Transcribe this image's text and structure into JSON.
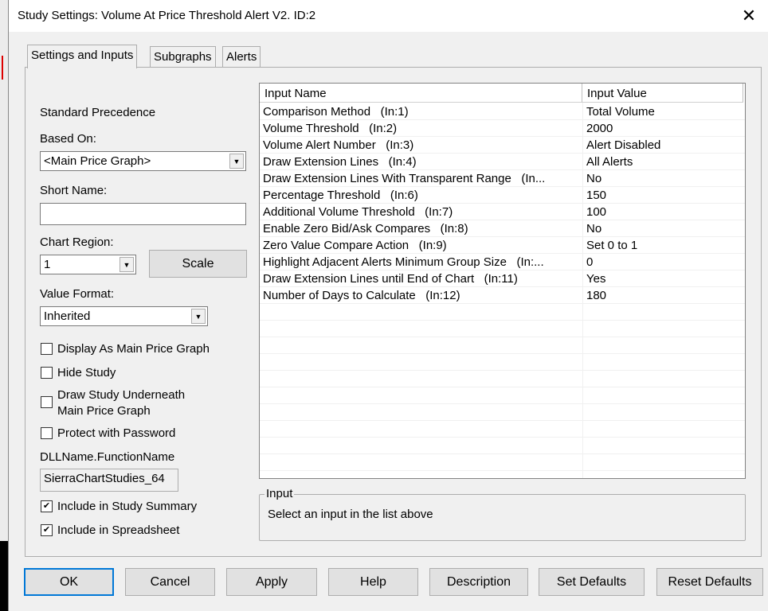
{
  "window": {
    "title": "Study Settings: Volume At Price Threshold Alert V2. ID:2",
    "close": "✕"
  },
  "tabs": [
    {
      "label": "Settings and Inputs"
    },
    {
      "label": "Subgraphs"
    },
    {
      "label": "Alerts"
    }
  ],
  "left": {
    "standard_precedence": "Standard Precedence",
    "based_on_label": "Based On:",
    "based_on_value": "<Main Price Graph>",
    "short_name_label": "Short Name:",
    "short_name_value": "",
    "chart_region_label": "Chart Region:",
    "chart_region_value": "1",
    "scale_button": "Scale",
    "value_format_label": "Value Format:",
    "value_format_value": "Inherited",
    "checkboxes": [
      {
        "label": "Display As Main Price Graph",
        "checked": false
      },
      {
        "label": "Hide Study",
        "checked": false
      },
      {
        "label": "Draw Study Underneath",
        "label2": "Main Price Graph",
        "checked": false
      },
      {
        "label": "Protect with Password",
        "checked": false
      }
    ],
    "dll_label": "DLLName.FunctionName",
    "dll_value": "SierraChartStudies_64",
    "include": [
      {
        "label": "Include in Study Summary",
        "checked": true,
        "mark": "✔"
      },
      {
        "label": "Include in Spreadsheet",
        "checked": true,
        "mark": "✔"
      }
    ]
  },
  "table": {
    "headers": [
      "Input Name",
      "Input Value"
    ],
    "rows": [
      {
        "name": "Comparison Method   (In:1)",
        "value": "Total Volume"
      },
      {
        "name": "Volume Threshold   (In:2)",
        "value": "2000"
      },
      {
        "name": "Volume Alert Number   (In:3)",
        "value": "Alert Disabled"
      },
      {
        "name": "Draw Extension Lines   (In:4)",
        "value": "All Alerts"
      },
      {
        "name": "Draw Extension Lines With Transparent Range   (In...",
        "value": "No"
      },
      {
        "name": "Percentage Threshold   (In:6)",
        "value": "150"
      },
      {
        "name": "Additional Volume Threshold   (In:7)",
        "value": "100"
      },
      {
        "name": "Enable Zero Bid/Ask Compares   (In:8)",
        "value": "No"
      },
      {
        "name": "Zero Value Compare Action   (In:9)",
        "value": "Set 0 to 1"
      },
      {
        "name": "Highlight Adjacent Alerts Minimum Group Size   (In:...",
        "value": "0"
      },
      {
        "name": "Draw Extension Lines until End of Chart   (In:11)",
        "value": "Yes"
      },
      {
        "name": "Number of Days to Calculate   (In:12)",
        "value": "180"
      }
    ]
  },
  "input_group": {
    "title": "Input",
    "text": "Select an input in the list above"
  },
  "buttons": {
    "ok": "OK",
    "cancel": "Cancel",
    "apply": "Apply",
    "help": "Help",
    "description": "Description",
    "set_defaults": "Set Defaults",
    "reset_defaults": "Reset Defaults"
  }
}
